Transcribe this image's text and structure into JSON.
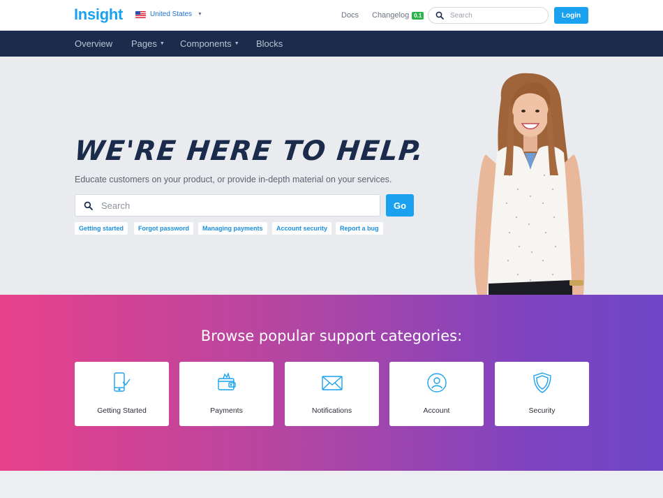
{
  "header": {
    "logo": "Insight",
    "locale": "United States",
    "links": {
      "docs": "Docs",
      "changelog": "Changelog",
      "changelog_badge": "0.1"
    },
    "search_placeholder": "Search",
    "login_label": "Login"
  },
  "nav": {
    "items": [
      {
        "label": "Overview",
        "has_dropdown": false
      },
      {
        "label": "Pages",
        "has_dropdown": true
      },
      {
        "label": "Components",
        "has_dropdown": true
      },
      {
        "label": "Blocks",
        "has_dropdown": false
      }
    ]
  },
  "hero": {
    "headline": "We're here to help.",
    "subtext": "Educate customers on your product, or provide in-depth material on your services.",
    "search_placeholder": "Search",
    "go_label": "Go",
    "quick_links": [
      "Getting started",
      "Forgot password",
      "Managing payments",
      "Account security",
      "Report a bug"
    ]
  },
  "categories": {
    "heading": "Browse popular support categories:",
    "items": [
      {
        "label": "Getting Started",
        "icon": "phone-check-icon"
      },
      {
        "label": "Payments",
        "icon": "wallet-icon"
      },
      {
        "label": "Notifications",
        "icon": "envelope-icon"
      },
      {
        "label": "Account",
        "icon": "user-circle-icon"
      },
      {
        "label": "Security",
        "icon": "shield-icon"
      }
    ]
  },
  "colors": {
    "brand": "#1aa1f0",
    "nav_bg": "#1a2b4c",
    "gradient_start": "#e8418b",
    "gradient_end": "#6e46c6",
    "badge": "#2bb34a"
  }
}
